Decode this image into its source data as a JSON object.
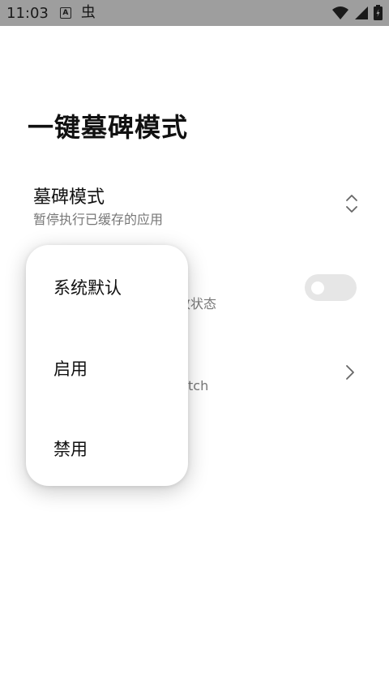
{
  "status_bar": {
    "time": "11:03",
    "a_badge": "A",
    "bug_glyph": "虫",
    "icons": [
      "wifi-icon",
      "signal-icon",
      "battery-icon"
    ]
  },
  "page": {
    "title": "一键墓碑模式"
  },
  "settings": {
    "tombstone_mode": {
      "title": "墓碑模式",
      "subtitle": "暂停执行已缓存的应用"
    },
    "row2_partial_subtitle": "致状态",
    "row3_partial_subtitle": "tch"
  },
  "dropdown": {
    "options": [
      "系统默认",
      "启用",
      "禁用"
    ]
  },
  "colors": {
    "status_bar_bg": "#9e9e9e",
    "toggle_off_bg": "#e6e6e6",
    "subtitle_gray": "#777777"
  }
}
